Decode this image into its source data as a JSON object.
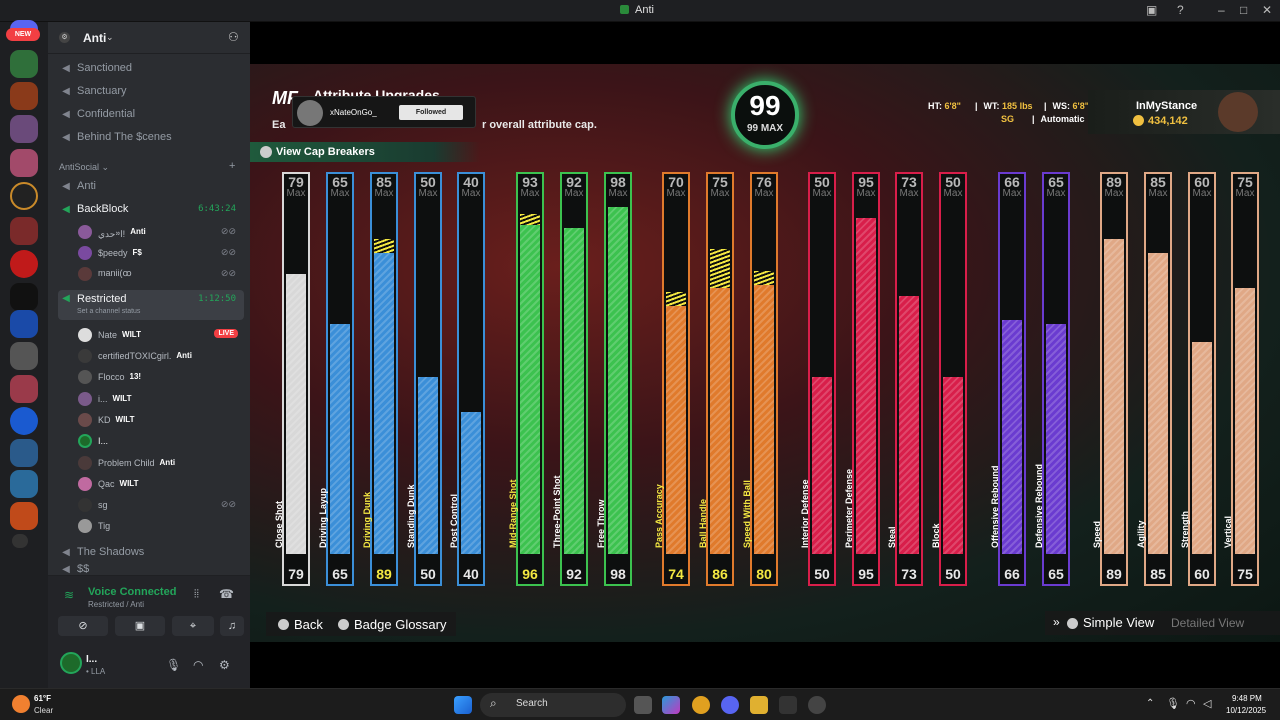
{
  "window": {
    "title": "Anti"
  },
  "rail": {
    "new_badge": "NEW"
  },
  "server": {
    "name": "Anti",
    "channels_top": [
      "Sanctioned",
      "Sanctuary",
      "Confidential",
      "Behind The $cenes"
    ],
    "category": "AntiSocial",
    "channel_anti": "Anti",
    "backblock": {
      "name": "BackBlock",
      "timer": "6:43:24"
    },
    "backblock_users": [
      {
        "name": "ا᠉حدي!",
        "tag": "Anti"
      },
      {
        "name": "$peedy",
        "tag": "F$"
      },
      {
        "name": "manii(ꝏ",
        "tag": ""
      }
    ],
    "restricted": {
      "name": "Restricted",
      "timer": "1:12:50",
      "status": "Set a channel status"
    },
    "restricted_users": [
      {
        "name": "Nate",
        "tag": "WILT",
        "live": "LIVE"
      },
      {
        "name": "certifiedTOXICgirl.",
        "tag": "Anti"
      },
      {
        "name": "Flocco",
        "tag": "13!"
      },
      {
        "name": "i...",
        "tag": "WILT"
      },
      {
        "name": "KD",
        "tag": "WILT"
      },
      {
        "name": "I...",
        "tag": ""
      },
      {
        "name": "Problem Child",
        "tag": "Anti"
      },
      {
        "name": "Qac",
        "tag": "WILT"
      },
      {
        "name": "sg",
        "tag": ""
      },
      {
        "name": "Tig",
        "tag": ""
      }
    ],
    "channel_shadows": "The Shadows",
    "channel_ss": "$$"
  },
  "voice": {
    "title": "Voice Connected",
    "sub": "Restricted / Anti"
  },
  "user": {
    "name": "I...",
    "status": "• LLA"
  },
  "game": {
    "logo": "MF",
    "title": "Attribute Upgrades",
    "subtitle_left": "Ea",
    "subtitle_right": "r overall attribute cap.",
    "cap_breakers": "View Cap Breakers",
    "popup": {
      "name": "xNateOnGo_",
      "button": "Followed"
    },
    "overall": {
      "value": "99",
      "max_label": "99 MAX"
    },
    "player": {
      "ht_label": "HT:",
      "ht": "6'8\"",
      "wt_label": "WT:",
      "wt": "185 lbs",
      "ws_label": "WS:",
      "ws": "6'8\"",
      "pos": "SG",
      "style": "Automatic",
      "gamertag": "InMyStance",
      "vc": "434,142"
    },
    "max_label": "Max",
    "footer": {
      "back": "Back",
      "glossary": "Badge Glossary",
      "simple": "Simple View",
      "detailed": "Detailed View"
    }
  },
  "attributes": [
    {
      "name": "Close Shot",
      "cap": 79,
      "value": 79,
      "upgraded": 0,
      "color": "#d8d8d8"
    },
    {
      "name": "Driving Layup",
      "cap": 65,
      "value": 65,
      "upgraded": 0,
      "color": "#3b8fd8"
    },
    {
      "name": "Driving Dunk",
      "cap": 85,
      "value": 89,
      "upgraded": 4,
      "color": "#3b8fd8"
    },
    {
      "name": "Standing Dunk",
      "cap": 50,
      "value": 50,
      "upgraded": 0,
      "color": "#3b8fd8"
    },
    {
      "name": "Post Control",
      "cap": 40,
      "value": 40,
      "upgraded": 0,
      "color": "#3b8fd8"
    },
    {
      "name": "Mid-Range Shot",
      "cap": 93,
      "value": 96,
      "upgraded": 3,
      "color": "#3cc24f"
    },
    {
      "name": "Three-Point Shot",
      "cap": 92,
      "value": 92,
      "upgraded": 0,
      "color": "#3cc24f"
    },
    {
      "name": "Free Throw",
      "cap": 98,
      "value": 98,
      "upgraded": 0,
      "color": "#3cc24f"
    },
    {
      "name": "Pass Accuracy",
      "cap": 70,
      "value": 74,
      "upgraded": 4,
      "color": "#e07a2c"
    },
    {
      "name": "Ball Handle",
      "cap": 75,
      "value": 86,
      "upgraded": 11,
      "color": "#e07a2c"
    },
    {
      "name": "Speed With Ball",
      "cap": 76,
      "value": 80,
      "upgraded": 4,
      "color": "#e07a2c"
    },
    {
      "name": "Interior Defense",
      "cap": 50,
      "value": 50,
      "upgraded": 0,
      "color": "#d81e4a"
    },
    {
      "name": "Perimeter Defense",
      "cap": 95,
      "value": 95,
      "upgraded": 0,
      "color": "#d81e4a"
    },
    {
      "name": "Steal",
      "cap": 73,
      "value": 73,
      "upgraded": 0,
      "color": "#d81e4a"
    },
    {
      "name": "Block",
      "cap": 50,
      "value": 50,
      "upgraded": 0,
      "color": "#d81e4a"
    },
    {
      "name": "Offensive Rebound",
      "cap": 66,
      "value": 66,
      "upgraded": 0,
      "color": "#6a3bd0"
    },
    {
      "name": "Defensive Rebound",
      "cap": 65,
      "value": 65,
      "upgraded": 0,
      "color": "#6a3bd0"
    },
    {
      "name": "Speed",
      "cap": 89,
      "value": 89,
      "upgraded": 0,
      "color": "#e0a886"
    },
    {
      "name": "Agility",
      "cap": 85,
      "value": 85,
      "upgraded": 0,
      "color": "#e0a886"
    },
    {
      "name": "Strength",
      "cap": 60,
      "value": 60,
      "upgraded": 0,
      "color": "#e0a886"
    },
    {
      "name": "Vertical",
      "cap": 75,
      "value": 75,
      "upgraded": 0,
      "color": "#e0a886"
    }
  ],
  "taskbar": {
    "search": "Search",
    "temp": "61°F",
    "weather": "Clear",
    "time": "9:48 PM",
    "date": "10/12/2025"
  }
}
